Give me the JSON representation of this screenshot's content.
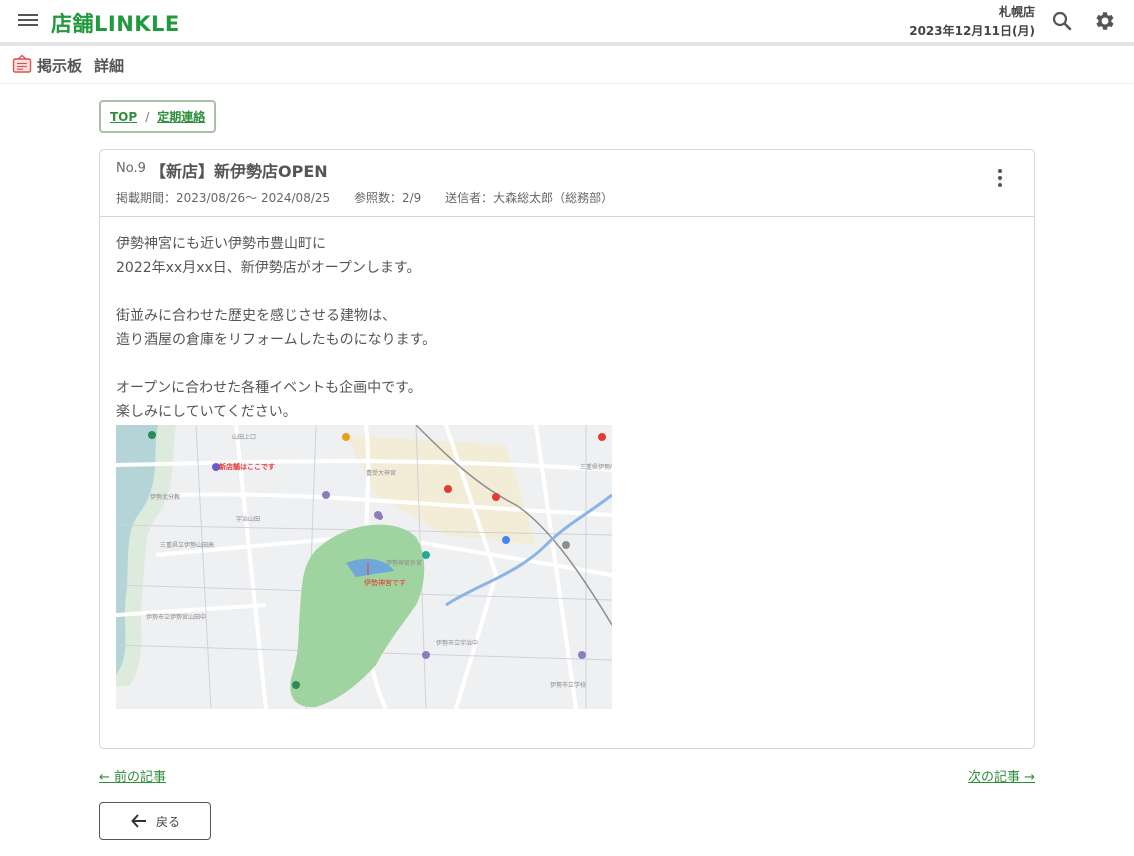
{
  "header": {
    "logo": "店舗LINKLE",
    "store_name": "札幌店",
    "date": "2023年12月11日(月)",
    "icons": {
      "menu": "menu-icon",
      "search": "search-icon",
      "settings": "gear-icon"
    }
  },
  "subheader": {
    "icon": "board-icon",
    "section": "掲示板",
    "page": "詳細"
  },
  "breadcrumb": {
    "top": "TOP",
    "separator": "/",
    "category": "定期連絡"
  },
  "post": {
    "number": "No.9",
    "title": "【新店】新伊勢店OPEN",
    "period": "掲載期間：2023/08/26～ 2024/08/25",
    "views": "参照数：2/9",
    "sender": "送信者：大森総太郎（総務部）",
    "body": "伊勢神宮にも近い伊勢市豊山町に\n2022年xx月xx日、新伊勢店がオープンします。\n\n街並みに合わせた歴史を感じさせる建物は、\n造り酒屋の倉庫をリフォームしたものになります。\n\nオープンに合わせた各種イベントも企画中です。\n楽しみにしていてください。",
    "map": {
      "label_store": "新店舗はここです",
      "label_shrine": "伊勢神宮です"
    }
  },
  "nav": {
    "prev": "← 前の記事",
    "next": "次の記事 →",
    "back": "戻る"
  },
  "colors": {
    "brand_green": "#1f9a3c",
    "link_green": "#2f8f3a",
    "map_red": "#e53935"
  }
}
